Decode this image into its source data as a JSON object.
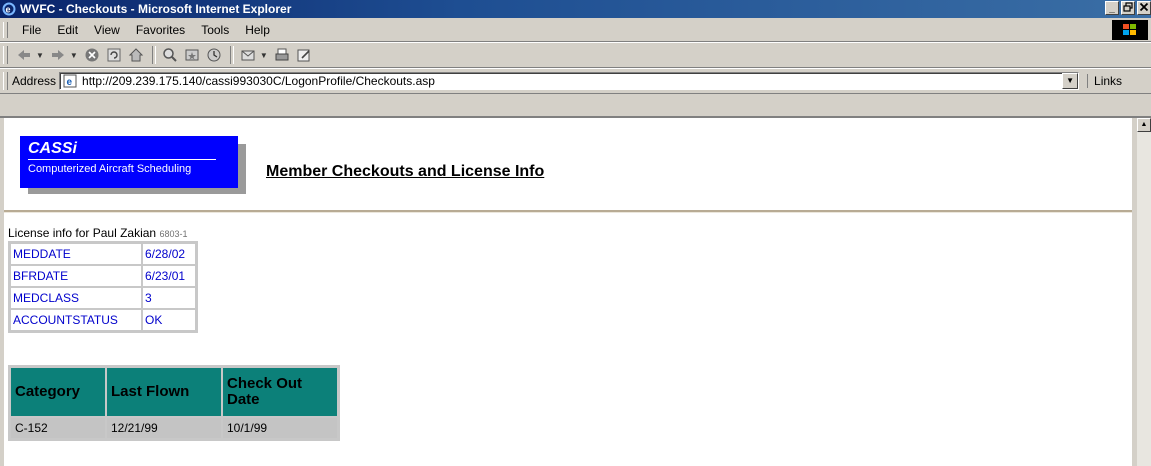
{
  "window": {
    "title": "WVFC - Checkouts - Microsoft Internet Explorer",
    "controls": [
      "_",
      "ф",
      "×"
    ]
  },
  "menu": {
    "items": [
      "File",
      "Edit",
      "View",
      "Favorites",
      "Tools",
      "Help"
    ]
  },
  "toolbar": {
    "icons": [
      "back-arrow-icon",
      "forward-arrow-icon",
      "stop-icon",
      "refresh-icon",
      "home-icon",
      "search-icon",
      "favorites-icon",
      "history-icon",
      "mail-icon",
      "print-icon",
      "edit-icon"
    ]
  },
  "address": {
    "label": "Address",
    "url": "http://209.239.175.140/cassi993030C/LogonProfile/Checkouts.asp",
    "links_label": "Links"
  },
  "page": {
    "logo": {
      "brand": "CASSi",
      "tagline": "Computerized Aircraft Scheduling"
    },
    "title": "Member Checkouts and License Info",
    "license": {
      "caption": "License info for Paul Zakian",
      "member_id": "6803-1",
      "rows": [
        {
          "key": "MEDDATE",
          "value": "6/28/02"
        },
        {
          "key": "BFRDATE",
          "value": "6/23/01"
        },
        {
          "key": "MEDCLASS",
          "value": "3"
        },
        {
          "key": "ACCOUNTSTATUS",
          "value": "OK"
        }
      ]
    },
    "checkouts": {
      "headers": [
        "Category",
        "Last Flown",
        "Check Out Date"
      ],
      "rows": [
        [
          "C-152",
          "12/21/99",
          "10/1/99"
        ]
      ]
    }
  },
  "colors": {
    "title_bar": "#0a246a",
    "logo_bg": "#0000ff",
    "table_header": "#0c8079",
    "link_text": "#0000cc",
    "row_bg": "#c4c4c4"
  }
}
